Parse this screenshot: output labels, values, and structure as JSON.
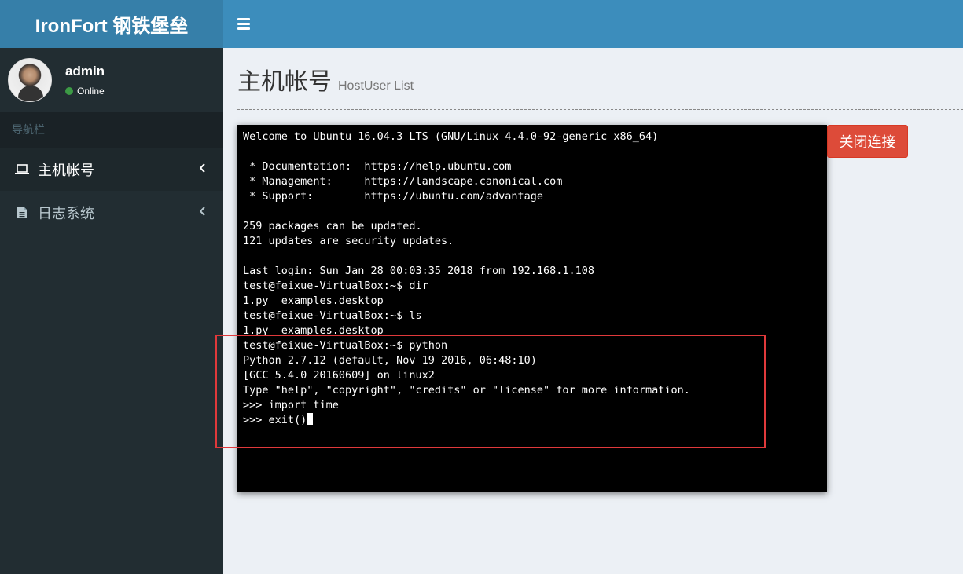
{
  "app": {
    "logo_text": "IronFort 钢铁堡垒"
  },
  "user": {
    "name": "admin",
    "status": "Online"
  },
  "nav": {
    "header": "导航栏",
    "items": [
      {
        "label": "主机帐号",
        "icon": "laptop-icon"
      },
      {
        "label": "日志系统",
        "icon": "file-text-icon"
      }
    ]
  },
  "page": {
    "title": "主机帐号",
    "subtitle": "HostUser List"
  },
  "actions": {
    "close_connection": "关闭连接"
  },
  "terminal": {
    "lines": [
      "Welcome to Ubuntu 16.04.3 LTS (GNU/Linux 4.4.0-92-generic x86_64)",
      "",
      " * Documentation:  https://help.ubuntu.com",
      " * Management:     https://landscape.canonical.com",
      " * Support:        https://ubuntu.com/advantage",
      "",
      "259 packages can be updated.",
      "121 updates are security updates.",
      "",
      "Last login: Sun Jan 28 00:03:35 2018 from 192.168.1.108",
      "test@feixue-VirtualBox:~$ dir",
      "1.py  examples.desktop",
      "test@feixue-VirtualBox:~$ ls",
      "1.py  examples.desktop",
      "test@feixue-VirtualBox:~$ python",
      "Python 2.7.12 (default, Nov 19 2016, 06:48:10)",
      "[GCC 5.4.0 20160609] on linux2",
      "Type \"help\", \"copyright\", \"credits\" or \"license\" for more information.",
      ">>> import time",
      ">>> exit()"
    ]
  },
  "colors": {
    "header_blue": "#3c8dbc",
    "logo_blue": "#367fa9",
    "sidebar_bg": "#222d32",
    "danger": "#dd4b39",
    "highlight": "#e0393b"
  }
}
